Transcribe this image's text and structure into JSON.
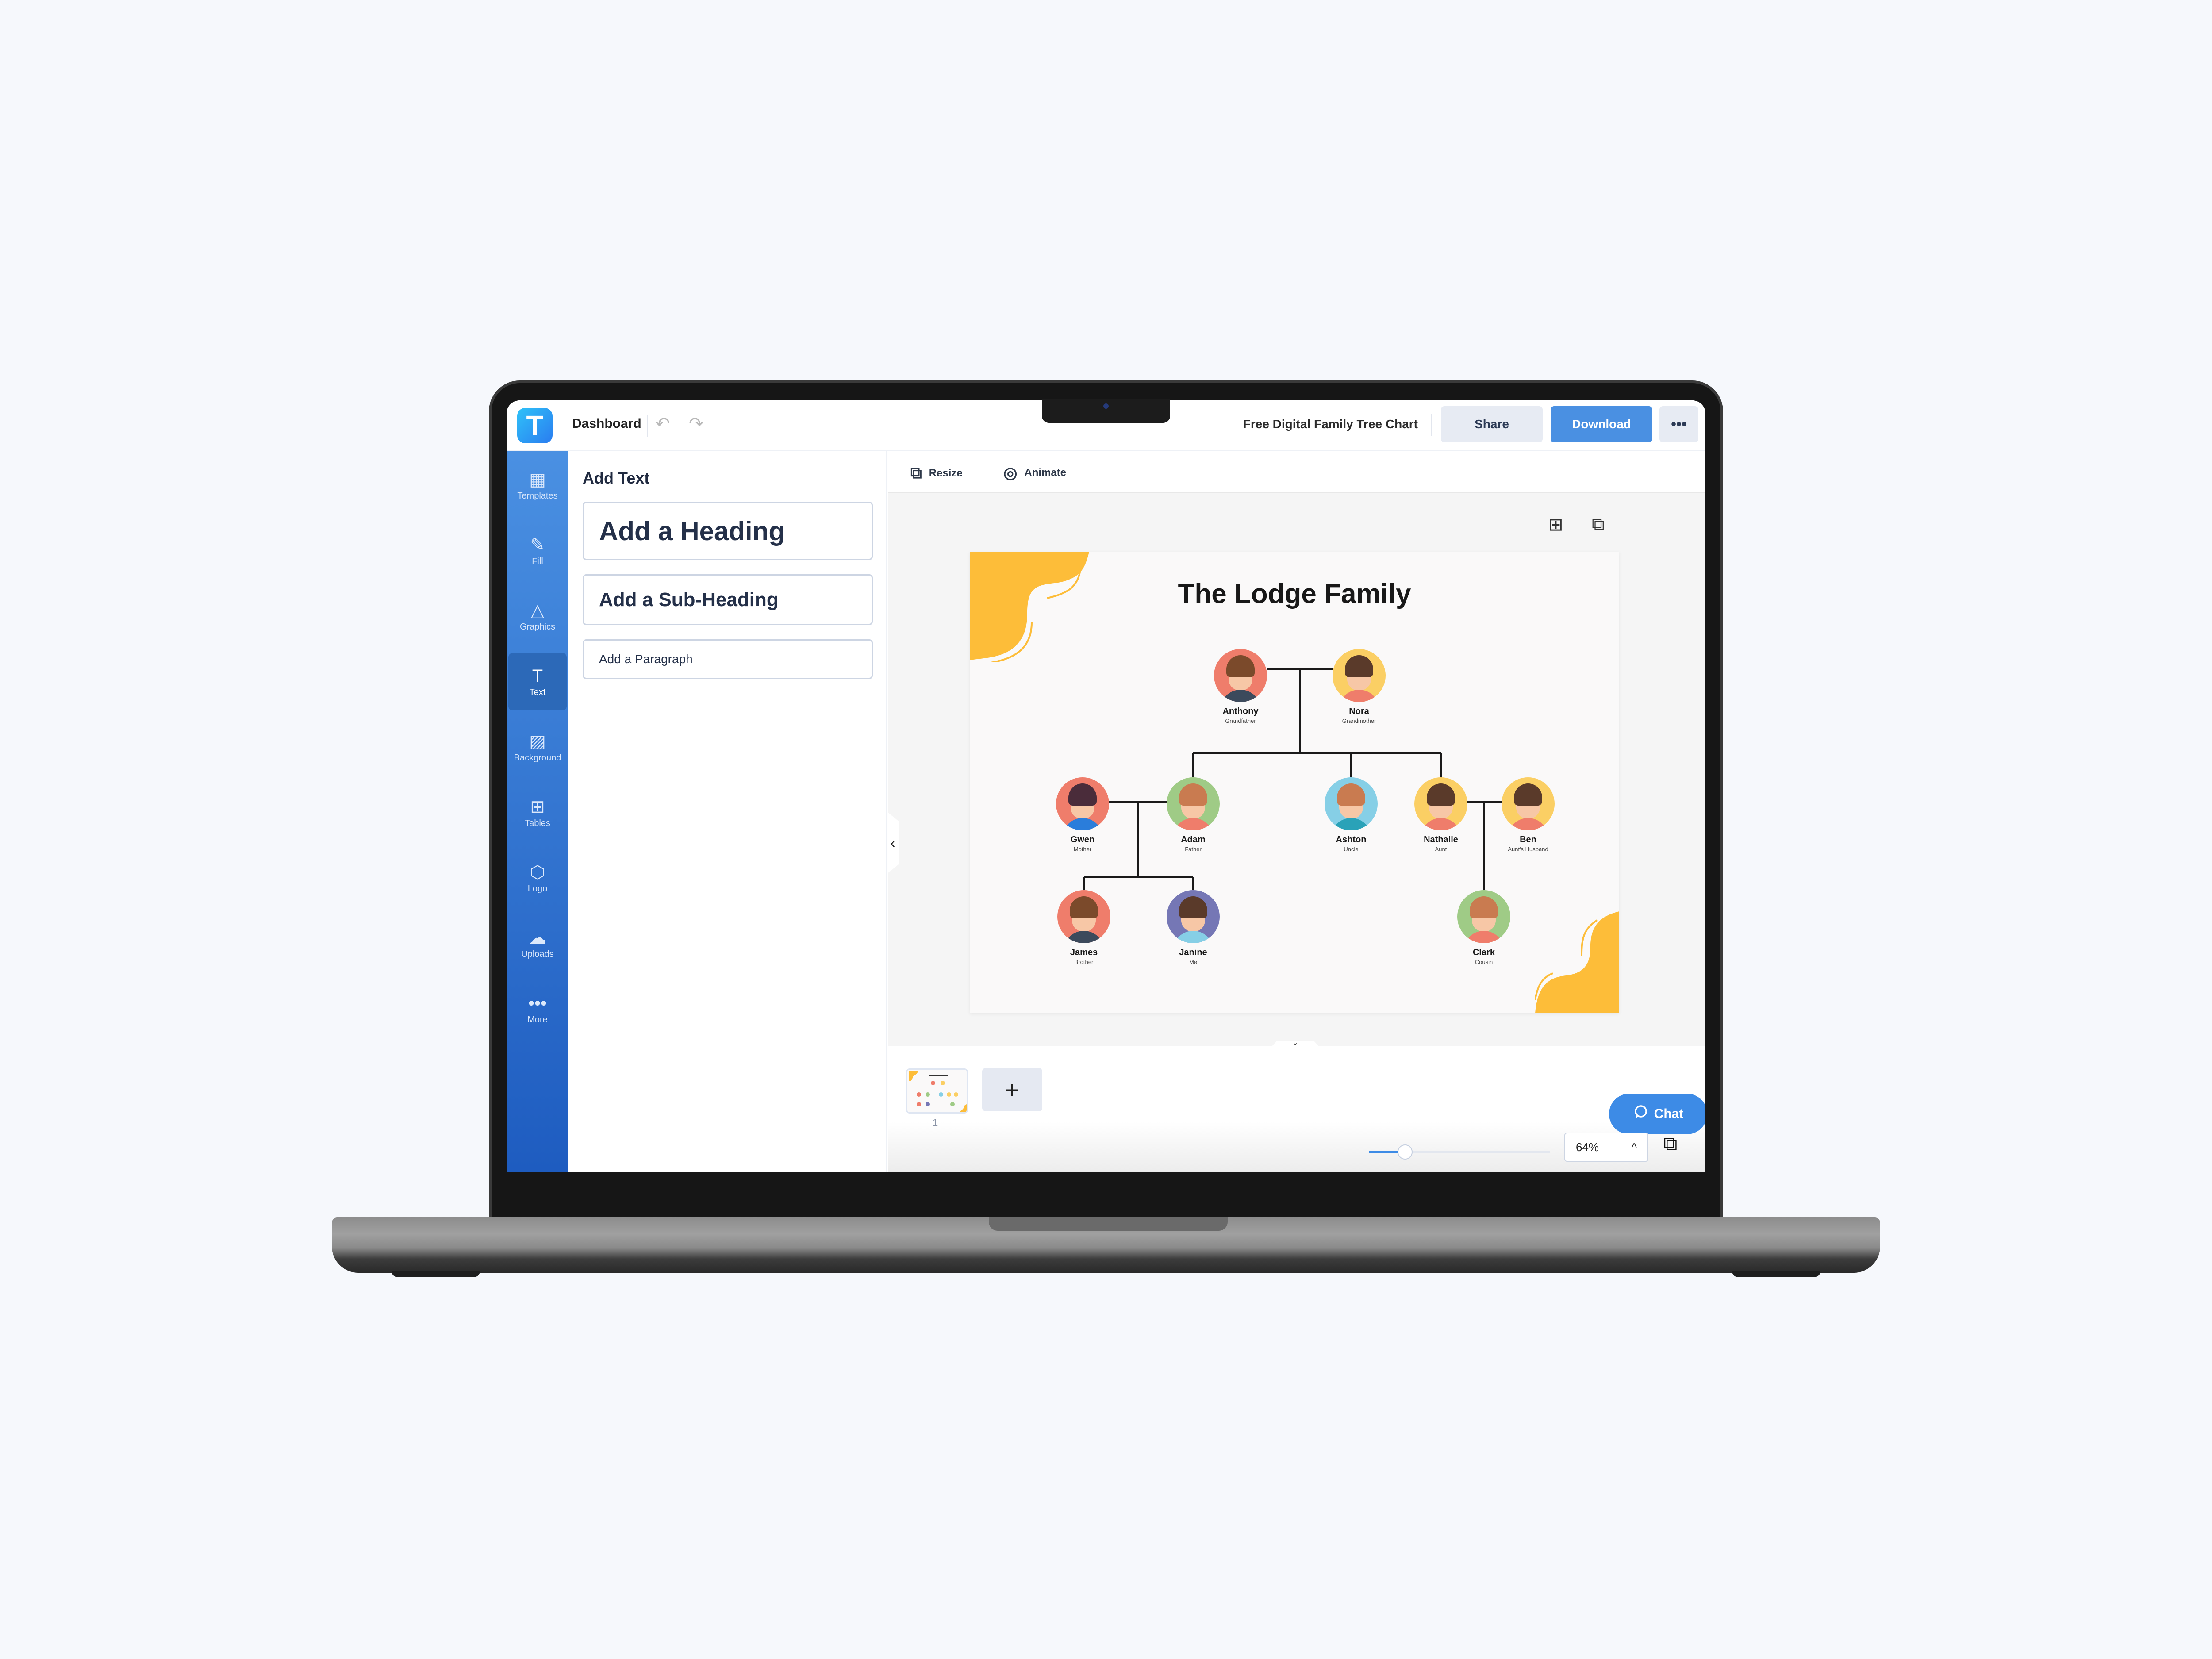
{
  "topbar": {
    "logo_letter": "T",
    "dashboard_label": "Dashboard",
    "undo_icon": "↶",
    "redo_icon": "↷",
    "document_title": "Free Digital Family Tree Chart",
    "share_label": "Share",
    "download_label": "Download",
    "more_label": "•••"
  },
  "sidebar": {
    "items": [
      {
        "label": "Templates",
        "icon": "▦",
        "active": false
      },
      {
        "label": "Fill",
        "icon": "✎",
        "active": false
      },
      {
        "label": "Graphics",
        "icon": "△",
        "active": false
      },
      {
        "label": "Text",
        "icon": "T",
        "active": true
      },
      {
        "label": "Background",
        "icon": "▨",
        "active": false
      },
      {
        "label": "Tables",
        "icon": "⊞",
        "active": false
      },
      {
        "label": "Logo",
        "icon": "⬡",
        "active": false
      },
      {
        "label": "Uploads",
        "icon": "☁",
        "active": false
      },
      {
        "label": "More",
        "icon": "•••",
        "active": false
      }
    ]
  },
  "panel": {
    "title": "Add Text",
    "heading_label": "Add a Heading",
    "subheading_label": "Add a Sub-Heading",
    "paragraph_label": "Add a Paragraph",
    "collapse_icon": "‹"
  },
  "toolbar": {
    "resize_label": "Resize",
    "resize_icon": "⧉",
    "animate_label": "Animate",
    "animate_icon": "◎",
    "add_page_icon": "⊞",
    "duplicate_icon": "⧉"
  },
  "design": {
    "title": "The Lodge Family",
    "accent_color": "#fdbd39",
    "people": [
      {
        "name": "Anthony",
        "role": "Grandfather",
        "bg": "#ef7d6b",
        "hair": "#7b4a2b",
        "shirt": "#3c4a5c"
      },
      {
        "name": "Nora",
        "role": "Grandmother",
        "bg": "#fbcf64",
        "hair": "#5a3a2a",
        "shirt": "#ef7d6b"
      },
      {
        "name": "Gwen",
        "role": "Mother",
        "bg": "#ef7d6b",
        "hair": "#4a2c3a",
        "shirt": "#2a7ddb"
      },
      {
        "name": "Adam",
        "role": "Father",
        "bg": "#9fcb86",
        "hair": "#c97b50",
        "shirt": "#ef7d6b"
      },
      {
        "name": "Ashton",
        "role": "Uncle",
        "bg": "#86cfe6",
        "hair": "#c97b50",
        "shirt": "#2aa2b8"
      },
      {
        "name": "Nathalie",
        "role": "Aunt",
        "bg": "#fbcf64",
        "hair": "#5a3a2a",
        "shirt": "#ef7d6b"
      },
      {
        "name": "Ben",
        "role": "Aunt's Husband",
        "bg": "#fbcf64",
        "hair": "#5a3a2a",
        "shirt": "#ef7d6b"
      },
      {
        "name": "James",
        "role": "Brother",
        "bg": "#ef7d6b",
        "hair": "#7b4a2b",
        "shirt": "#3c4a5c"
      },
      {
        "name": "Janine",
        "role": "Me",
        "bg": "#7577b5",
        "hair": "#5a3a2a",
        "shirt": "#86cfe6"
      },
      {
        "name": "Clark",
        "role": "Cousin",
        "bg": "#9fcb86",
        "hair": "#c97b50",
        "shirt": "#ef7d6b"
      }
    ]
  },
  "bottom": {
    "page_number": "1",
    "add_page_label": "+",
    "chat_label": "Chat",
    "chat_icon": "💬",
    "zoom_value": "64%",
    "zoom_fraction": 0.2,
    "zoom_chevron": "^",
    "pages_icon": "⧉"
  }
}
